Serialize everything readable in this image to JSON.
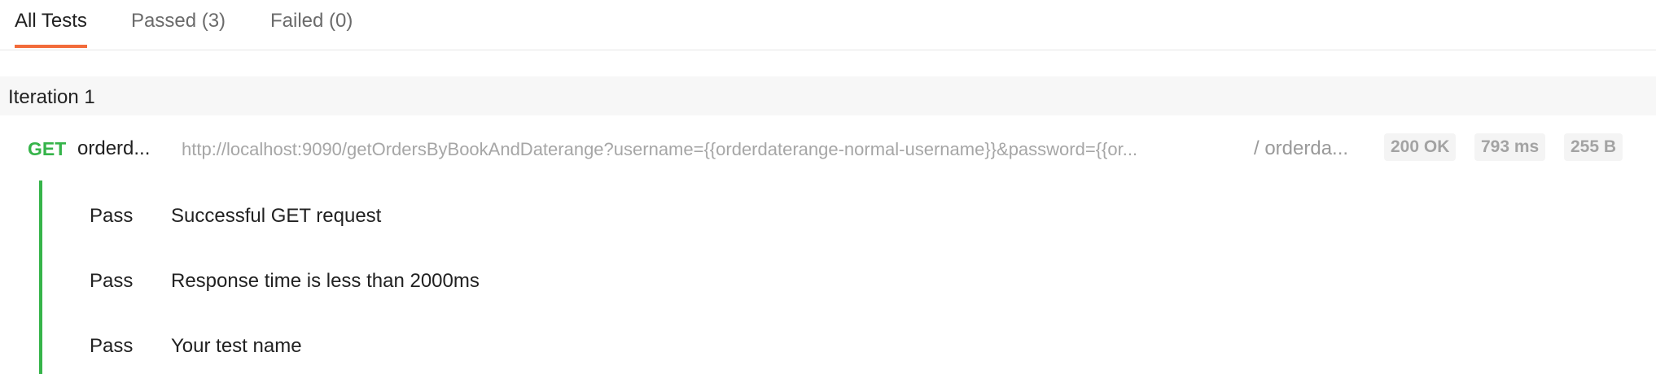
{
  "tabs": [
    {
      "label": "All Tests",
      "active": true
    },
    {
      "label": "Passed (3)",
      "active": false
    },
    {
      "label": "Failed (0)",
      "active": false
    }
  ],
  "iteration": {
    "label": "Iteration 1"
  },
  "request": {
    "method": "GET",
    "name": "orderd...",
    "url": "http://localhost:9090/getOrdersByBookAndDaterange?username={{orderdaterange-normal-username}}&password={{or...",
    "folder": "/ orderda...",
    "status": "200 OK",
    "time": "793 ms",
    "size": "255 B"
  },
  "results": [
    {
      "status": "Pass",
      "name": "Successful GET request"
    },
    {
      "status": "Pass",
      "name": "Response time is less than 2000ms"
    },
    {
      "status": "Pass",
      "name": "Your test name"
    }
  ],
  "colors": {
    "accent": "#f26b3a",
    "pass": "#36b44a"
  }
}
